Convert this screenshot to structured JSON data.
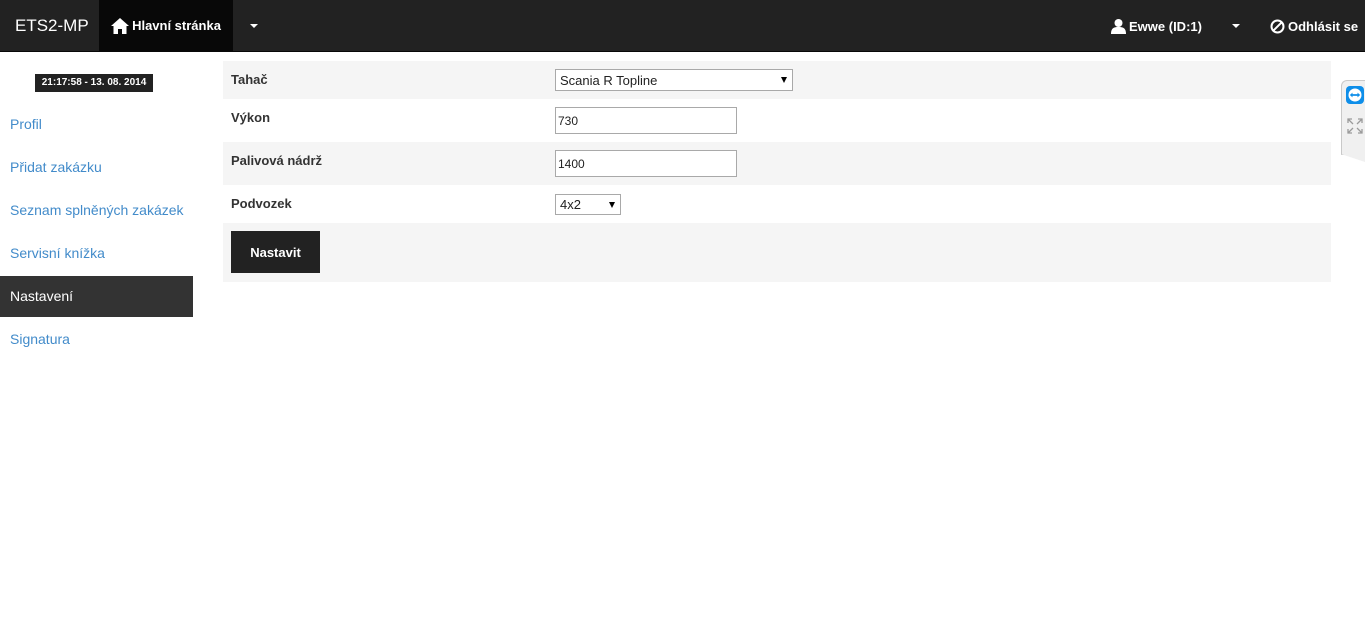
{
  "navbar": {
    "brand": "ETS2-MP",
    "home_label": "Hlavní stránka",
    "user_label": "Ewwe (ID:1)",
    "logout_label": "Odhlásit se"
  },
  "sidebar": {
    "clock": "21:17:58 - 13. 08. 2014",
    "items": [
      {
        "label": "Profil"
      },
      {
        "label": "Přidat zakázku"
      },
      {
        "label": "Seznam splněných zakázek"
      },
      {
        "label": "Servisní knížka"
      },
      {
        "label": "Nastavení",
        "active": true
      },
      {
        "label": "Signatura"
      }
    ]
  },
  "form": {
    "tractor": {
      "label": "Tahač",
      "value": "Scania R Topline"
    },
    "power": {
      "label": "Výkon",
      "value": "730"
    },
    "fuel_tank": {
      "label": "Palivová nádrž",
      "value": "1400"
    },
    "chassis": {
      "label": "Podvozek",
      "value": "4x2"
    },
    "submit_label": "Nastavit"
  },
  "colors": {
    "navbar_bg": "#222222",
    "nav_active_bg": "#080808",
    "link": "#428bca",
    "sidebar_active_bg": "#333333",
    "row_stripe": "#f5f5f5"
  },
  "icons": [
    "home-icon",
    "user-icon",
    "ban-icon",
    "teamviewer-icon",
    "expand-icon"
  ]
}
